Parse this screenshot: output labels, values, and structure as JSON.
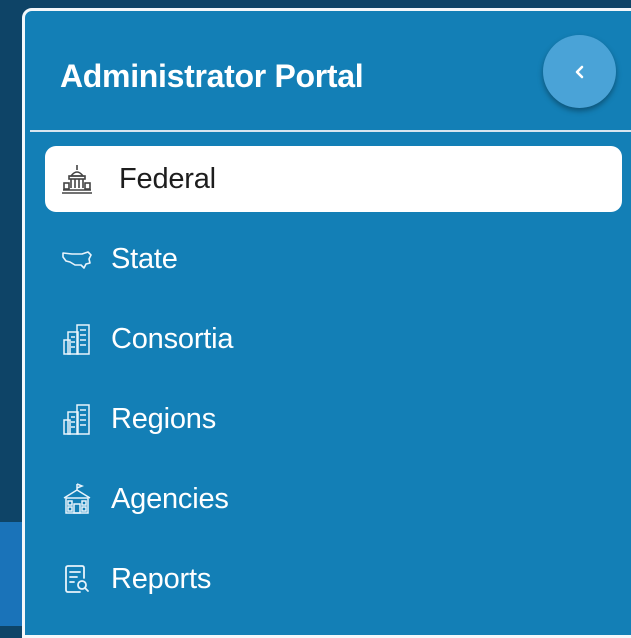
{
  "portal": {
    "title": "Administrator Portal"
  },
  "nav": {
    "items": [
      {
        "label": "Federal",
        "icon": "capitol-building-icon",
        "active": true
      },
      {
        "label": "State",
        "icon": "usa-map-icon",
        "active": false
      },
      {
        "label": "Consortia",
        "icon": "buildings-icon",
        "active": false
      },
      {
        "label": "Regions",
        "icon": "buildings-icon",
        "active": false
      },
      {
        "label": "Agencies",
        "icon": "school-building-icon",
        "active": false
      },
      {
        "label": "Reports",
        "icon": "report-search-icon",
        "active": false
      }
    ]
  },
  "colors": {
    "panel": "#137fb6",
    "page_bg": "#0e4467",
    "active_item_bg": "#ffffff",
    "collapse_button": "#4aa3d7"
  }
}
